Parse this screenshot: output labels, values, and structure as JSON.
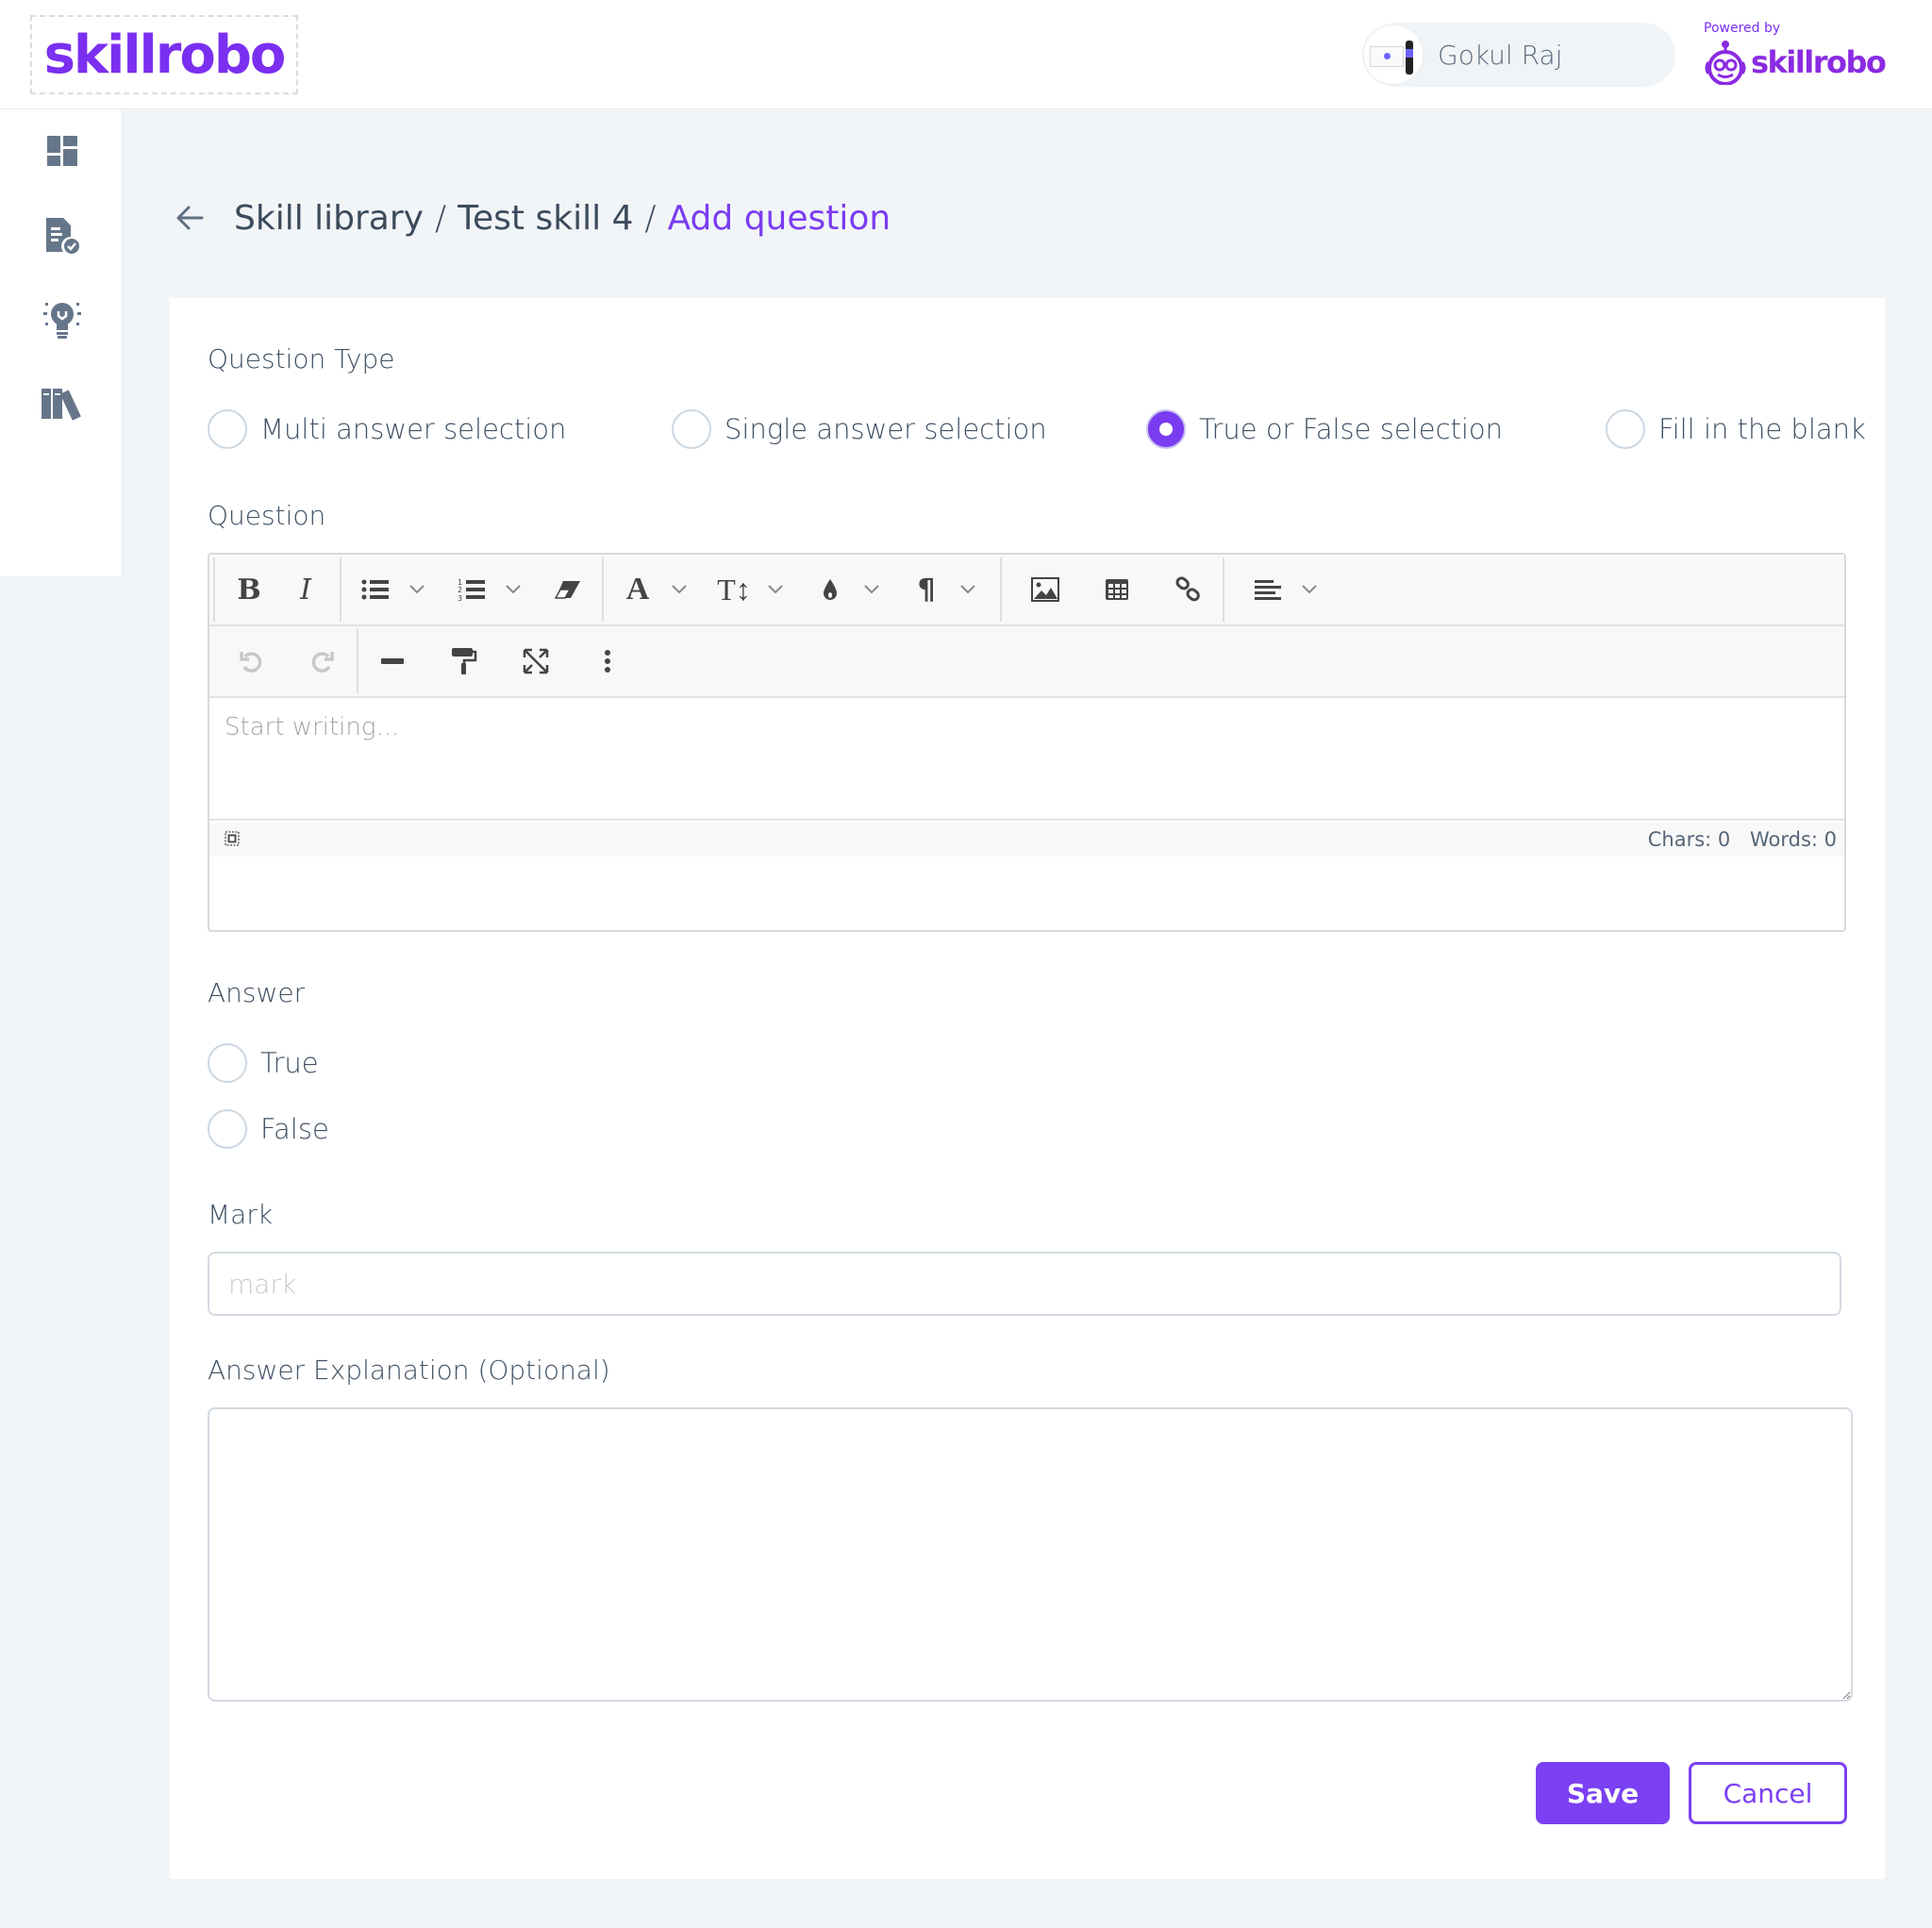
{
  "header": {
    "logo_text": "skillrobo",
    "user": {
      "name": "Gokul Raj"
    },
    "powered_by": {
      "label": "Powered by",
      "brand": "skillrobo"
    }
  },
  "sidebar": {
    "items": [
      {
        "name": "dashboard",
        "icon": "dashboard-icon"
      },
      {
        "name": "assessments",
        "icon": "document-check-icon"
      },
      {
        "name": "skills",
        "icon": "lightbulb-icon"
      },
      {
        "name": "library",
        "icon": "books-icon"
      }
    ]
  },
  "breadcrumb": {
    "items": [
      "Skill library",
      "Test skill 4"
    ],
    "current": "Add question",
    "separator": "/"
  },
  "form": {
    "question_type": {
      "label": "Question Type",
      "options": [
        {
          "label": "Multi answer selection",
          "selected": false
        },
        {
          "label": "Single answer selection",
          "selected": false
        },
        {
          "label": "True or False selection",
          "selected": true
        },
        {
          "label": "Fill in the blank",
          "selected": false
        }
      ]
    },
    "question": {
      "label": "Question",
      "placeholder": "Start writing...",
      "toolbar": {
        "row1": [
          "bold",
          "italic",
          "bulleted-list",
          "numbered-list",
          "eraser",
          "font-family",
          "font-size",
          "text-color",
          "paragraph",
          "image",
          "table",
          "link",
          "align"
        ],
        "row2": [
          "undo",
          "redo",
          "horizontal-rule",
          "format-painter",
          "fullsize",
          "more"
        ]
      },
      "status": {
        "chars_label": "Chars: 0",
        "words_label": "Words: 0"
      }
    },
    "answer": {
      "label": "Answer",
      "options": [
        {
          "label": "True",
          "selected": false
        },
        {
          "label": "False",
          "selected": false
        }
      ]
    },
    "mark": {
      "label": "Mark",
      "placeholder": "mark",
      "value": ""
    },
    "explanation": {
      "label": "Answer Explanation (Optional)",
      "value": ""
    },
    "buttons": {
      "save": "Save",
      "cancel": "Cancel"
    }
  },
  "colors": {
    "accent": "#7a40f2",
    "brand": "#7b2ff0",
    "background": "#f1f5f8",
    "text": "#3f5063"
  }
}
